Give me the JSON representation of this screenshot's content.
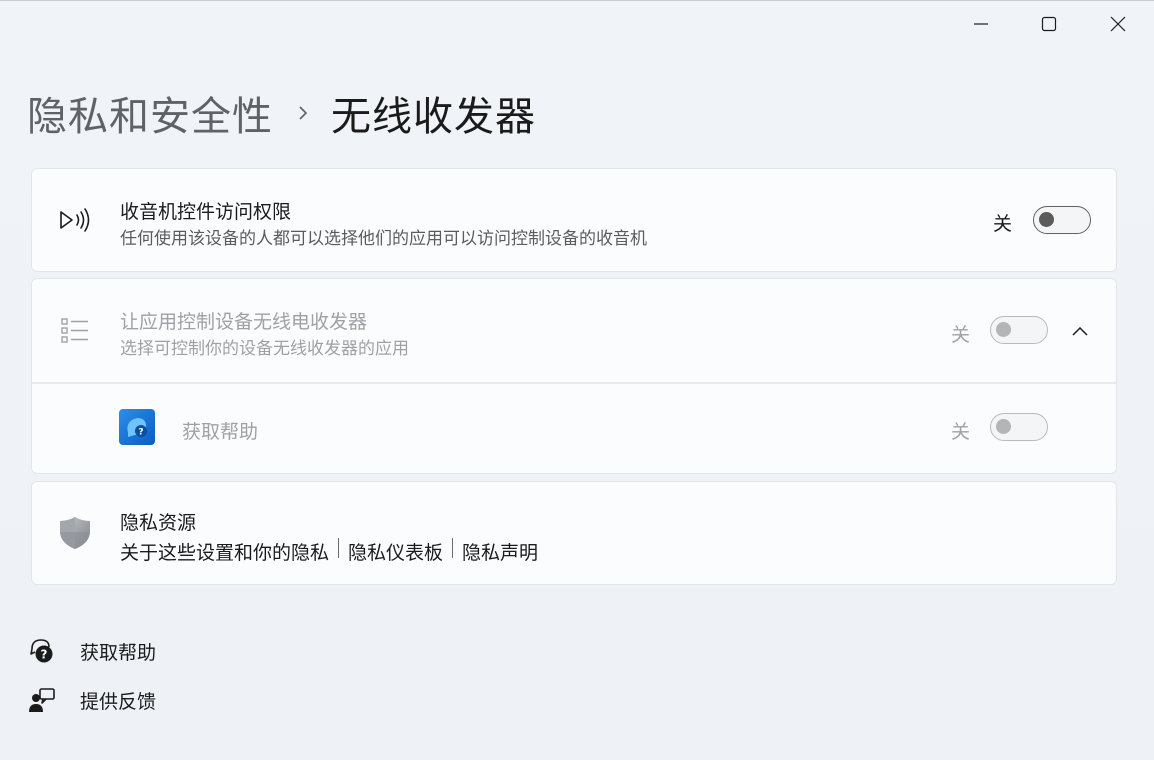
{
  "window": {
    "controls": {
      "minimize": "minimize-icon",
      "maximize": "maximize-icon",
      "close": "close-icon"
    }
  },
  "breadcrumb": {
    "parent": "隐私和安全性",
    "separator": "chevron-right-icon",
    "current": "无线收发器"
  },
  "radio_access": {
    "icon": "radio-signal-icon",
    "title": "收音机控件访问权限",
    "description": "任何使用该设备的人都可以选择他们的应用可以访问控制设备的收音机",
    "state_label": "关",
    "enabled": false
  },
  "app_radio_control": {
    "icon": "list-icon",
    "title": "让应用控制设备无线电收发器",
    "description": "选择可控制你的设备无线收发器的应用",
    "state_label": "关",
    "enabled": false,
    "expanded": true,
    "apps": [
      {
        "icon": "get-help-app-icon",
        "name": "获取帮助",
        "state_label": "关",
        "enabled": false
      }
    ]
  },
  "privacy_resources": {
    "icon": "shield-icon",
    "title": "隐私资源",
    "links": [
      "关于这些设置和你的隐私",
      "隐私仪表板",
      "隐私声明"
    ]
  },
  "footer": {
    "get_help": "获取帮助",
    "feedback": "提供反馈"
  },
  "colors": {
    "background": "#eef2f6",
    "card": "#fbfcfd",
    "text": "#1b1b1b",
    "text_secondary": "#5c5c5c",
    "text_disabled": "#9ea2a6",
    "app_icon_blue": "#1a73e8"
  }
}
